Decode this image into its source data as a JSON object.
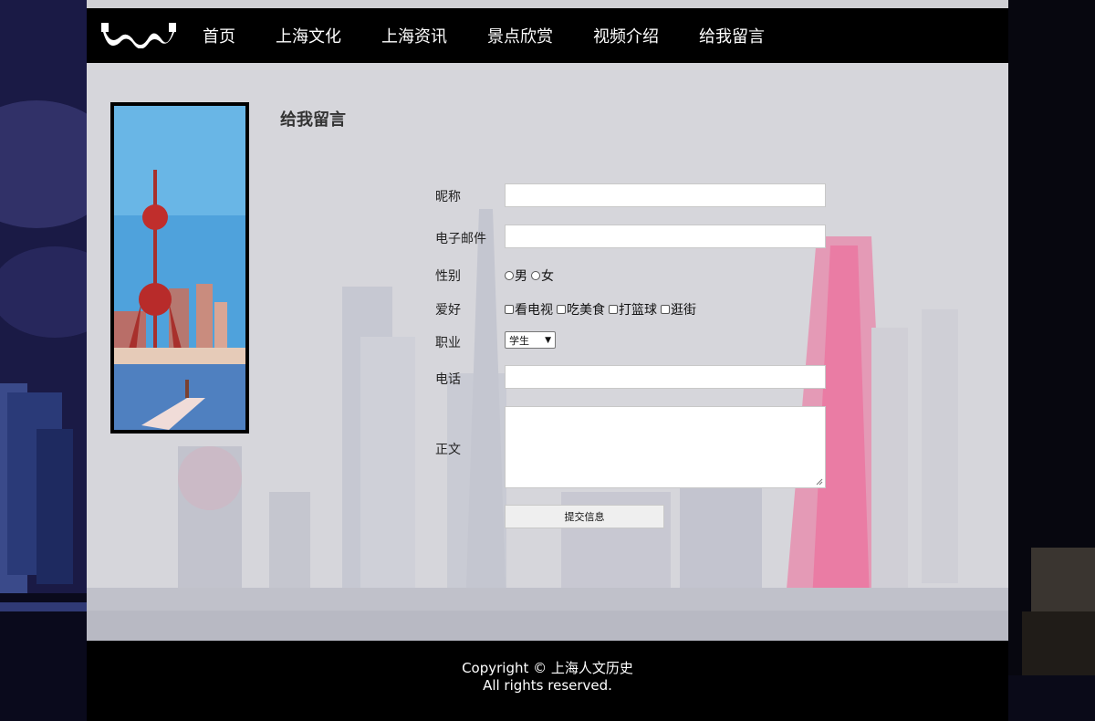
{
  "nav": {
    "items": [
      "首页",
      "上海文化",
      "上海资讯",
      "景点欣赏",
      "视频介绍",
      "给我留言"
    ]
  },
  "page": {
    "title": "给我留言"
  },
  "form": {
    "nickname_label": "昵称",
    "email_label": "电子邮件",
    "gender_label": "性别",
    "gender_options": [
      "男",
      "女"
    ],
    "hobby_label": "爱好",
    "hobby_options": [
      "看电视",
      "吃美食",
      "打篮球",
      "逛街"
    ],
    "job_label": "职业",
    "job_selected": "学生",
    "phone_label": "电话",
    "body_label": "正文",
    "submit_label": "提交信息"
  },
  "footer": {
    "copyright": "Copyright © 上海人文历史",
    "rights": "All rights reserved."
  },
  "colors": {
    "nav_bg": "#000000",
    "main_bg": "#d9d9dc",
    "accent_red": "#e8306a"
  }
}
